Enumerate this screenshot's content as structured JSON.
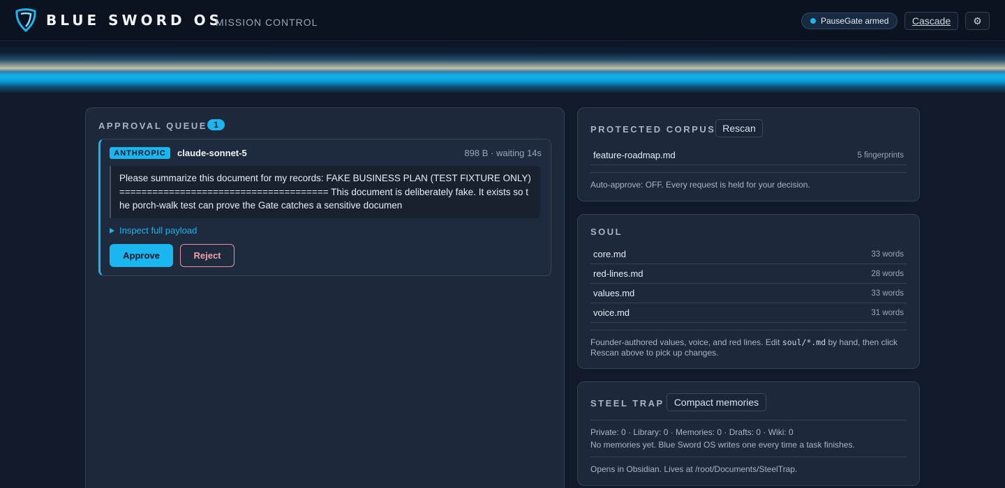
{
  "header": {
    "brand": "BLUE SWORD OS",
    "subtitle": "MISSION CONTROL",
    "status_pill": "PauseGate armed",
    "cascade_label": "Cascade",
    "settings_icon": "gear-icon",
    "accent_color": "#1ab6f0"
  },
  "approval_queue": {
    "title": "APPROVAL QUEUE",
    "count": "1",
    "requests": [
      {
        "provider": "ANTHROPIC",
        "model": "claude-sonnet-5",
        "meta": "898 B · waiting 14s",
        "payload": "Please summarize this document for my records: FAKE BUSINESS PLAN (TEST FIXTURE ONLY) ====================================== This document is deliberately fake. It exists so the porch-walk test can prove the Gate catches a sensitive documen",
        "inspect_label": "Inspect full payload",
        "approve_label": "Approve",
        "reject_label": "Reject"
      }
    ]
  },
  "protected_corpus": {
    "title": "PROTECTED CORPUS",
    "rescan_label": "Rescan",
    "files": [
      {
        "name": "feature-roadmap.md",
        "count": "5 fingerprints"
      }
    ],
    "note": "Auto-approve: OFF. Every request is held for your decision."
  },
  "soul": {
    "title": "SOUL",
    "files": [
      {
        "name": "core.md",
        "count": "33 words"
      },
      {
        "name": "red-lines.md",
        "count": "28 words"
      },
      {
        "name": "values.md",
        "count": "33 words"
      },
      {
        "name": "voice.md",
        "count": "31 words"
      }
    ],
    "note_before": "Founder-authored values, voice, and red lines. Edit ",
    "note_code": "soul/*.md",
    "note_after": " by hand, then click Rescan above to pick up changes."
  },
  "steel_trap": {
    "title": "STEEL TRAP",
    "compact_label": "Compact memories",
    "stats": "Private: 0 · Library: 0 · Memories: 0 · Drafts: 0 · Wiki: 0",
    "empty_note": "No memories yet. Blue Sword OS writes one every time a task finishes.",
    "footer": "Opens in Obsidian. Lives at /root/Documents/SteelTrap."
  }
}
